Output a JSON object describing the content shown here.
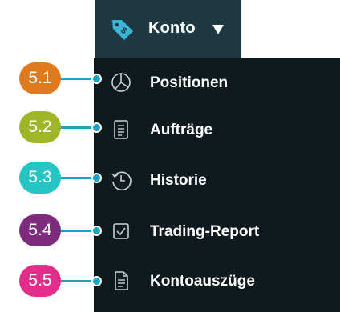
{
  "header": {
    "label": "Konto",
    "icon": "price-tag-icon",
    "caret_icon": "caret-down-icon"
  },
  "menu": {
    "items": [
      {
        "label": "Positionen",
        "icon": "pie-chart-icon",
        "callout": "5.1",
        "color": "#e07a1f"
      },
      {
        "label": "Aufträge",
        "icon": "document-list-icon",
        "callout": "5.2",
        "color": "#9fb628"
      },
      {
        "label": "Historie",
        "icon": "history-clock-icon",
        "callout": "5.3",
        "color": "#27c4c4"
      },
      {
        "label": "Trading-Report",
        "icon": "checkbox-icon",
        "callout": "5.4",
        "color": "#7d2b7c"
      },
      {
        "label": "Kontoauszüge",
        "icon": "statement-document-icon",
        "callout": "5.5",
        "color": "#e22e8a"
      }
    ]
  },
  "colors": {
    "bar": "#1f3942",
    "menu_bg": "#10191d",
    "accent": "#1aa3c3",
    "text": "#ffffff"
  }
}
